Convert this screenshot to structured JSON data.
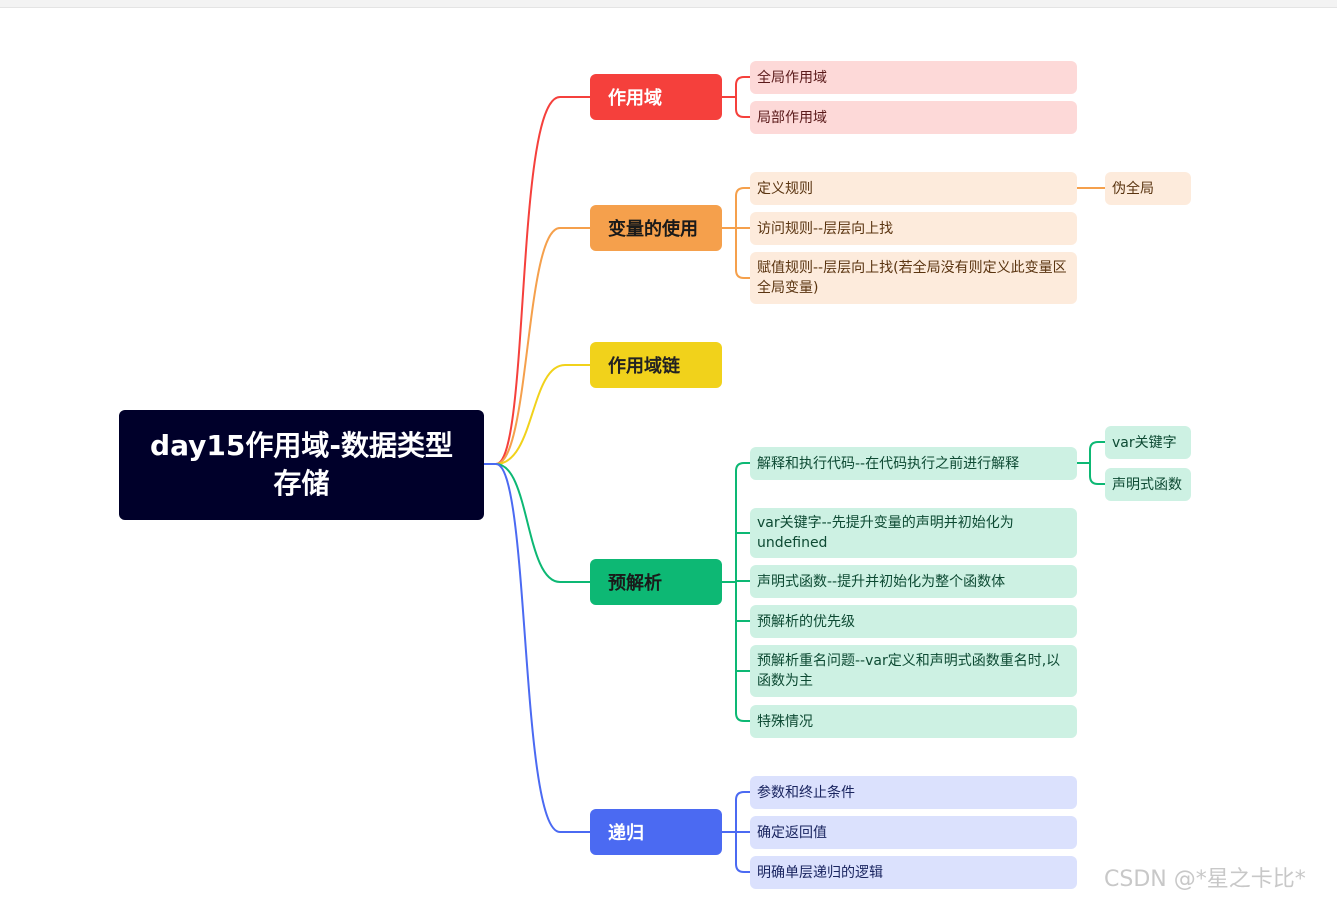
{
  "root": {
    "title": "day15作用域-数据类型存储"
  },
  "branches": {
    "scope": {
      "label": "作用域",
      "color": "#f5403c",
      "leaf_bg": "#fdd9d8",
      "leaf_text": "#5a1a1a",
      "items": [
        "全局作用域",
        "局部作用域"
      ]
    },
    "variable": {
      "label": "变量的使用",
      "color": "#f5a04c",
      "leaf_bg": "#fdebdc",
      "leaf_text": "#5a3410",
      "items": [
        "定义规则",
        "访问规则--层层向上找",
        "赋值规则--层层向上找(若全局没有则定义此变量区全局变量)"
      ],
      "sub": [
        "伪全局"
      ]
    },
    "chain": {
      "label": "作用域链",
      "color": "#f1d21b",
      "text_color": "#222222"
    },
    "preparse": {
      "label": "预解析",
      "color": "#0db874",
      "leaf_bg": "#cdf1e3",
      "leaf_text": "#0d4a33",
      "items": [
        "解释和执行代码--在代码执行之前进行解释",
        "var关键字--先提升变量的声明并初始化为undefined",
        "声明式函数--提升并初始化为整个函数体",
        "预解析的优先级",
        "预解析重名问题--var定义和声明式函数重名时,以函数为主",
        "特殊情况"
      ],
      "sub": [
        "var关键字",
        "声明式函数"
      ]
    },
    "recursion": {
      "label": "递归",
      "color": "#4b6af2",
      "leaf_bg": "#dbe1fd",
      "leaf_text": "#1a2560",
      "items": [
        "参数和终止条件",
        "确定返回值",
        "明确单层递归的逻辑"
      ]
    }
  },
  "root_color": "#00002a",
  "watermark": "CSDN @*星之卡比*"
}
